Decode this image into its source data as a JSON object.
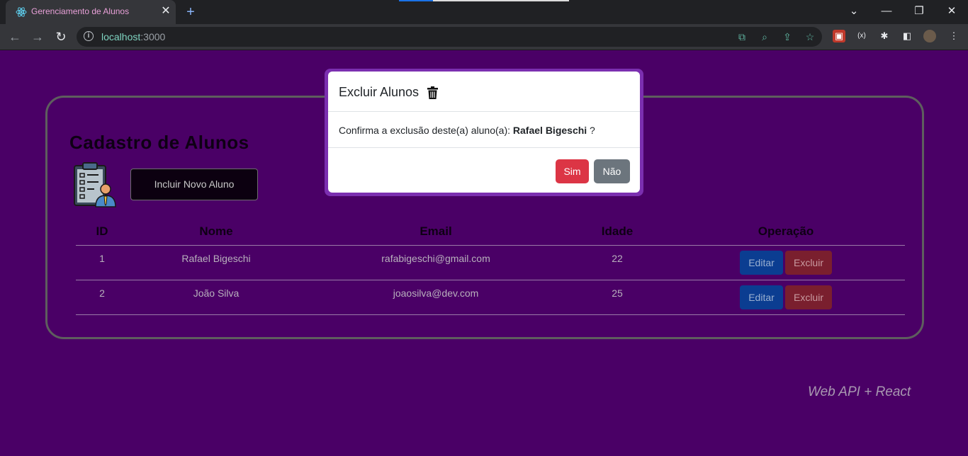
{
  "browser": {
    "tab_title": "Gerenciamento de Alunos",
    "url_host": "localhost",
    "url_port": ":3000"
  },
  "page": {
    "title": "Cadastro de Alunos",
    "add_button": "Incluir Novo Aluno",
    "footer": "Web API + React"
  },
  "table": {
    "headers": [
      "ID",
      "Nome",
      "Email",
      "Idade",
      "Operação"
    ],
    "rows": [
      {
        "id": "1",
        "nome": "Rafael Bigeschi",
        "email": "rafabigeschi@gmail.com",
        "idade": "22"
      },
      {
        "id": "2",
        "nome": "João Silva",
        "email": "joaosilva@dev.com",
        "idade": "25"
      }
    ],
    "edit_label": "Editar",
    "delete_label": "Excluir"
  },
  "modal": {
    "title": "Excluir Alunos",
    "message_prefix": "Confirma a exclusão deste(a) aluno(a): ",
    "student_name": "Rafael Bigeschi",
    "message_suffix": " ?",
    "yes_label": "Sim",
    "no_label": "Não"
  },
  "colors": {
    "page_background": "#4a0066",
    "danger": "#dc3545",
    "secondary": "#6c757d",
    "primary": "#0b3d91"
  }
}
